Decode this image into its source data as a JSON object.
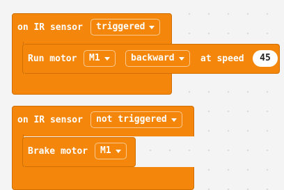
{
  "event1": {
    "label": "on IR sensor",
    "state": "triggered",
    "run": {
      "label": "Run motor",
      "motor": "M1",
      "direction": "backward",
      "speed_label": "at speed",
      "speed": "45"
    }
  },
  "event2": {
    "label": "on IR sensor",
    "state": "not triggered",
    "brake": {
      "label": "Brake motor",
      "motor": "M1"
    }
  },
  "colors": {
    "block": "#f4870b",
    "block_border": "#d06f00",
    "workspace": "#f4f4f4",
    "text": "#ffffff"
  },
  "icons": {
    "dropdown": "caret-down-icon"
  }
}
